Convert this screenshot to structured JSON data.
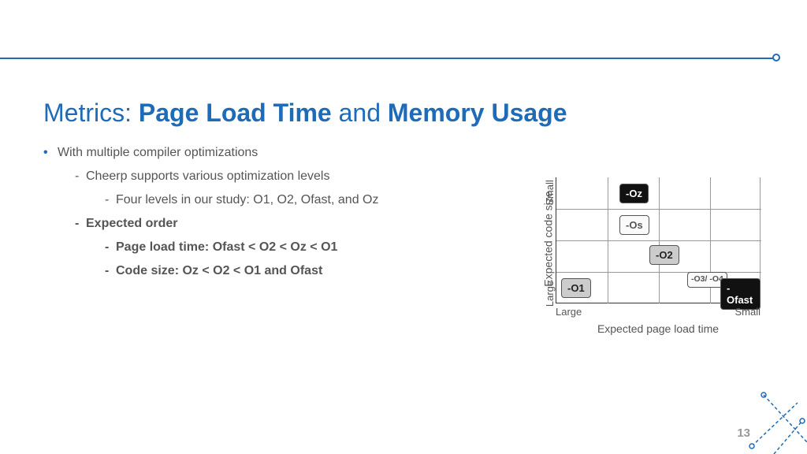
{
  "title": {
    "prefix": "Metrics: ",
    "strong1": "Page Load Time",
    "mid": " and ",
    "strong2": "Memory Usage"
  },
  "bullets": {
    "l1": "With multiple compiler optimizations",
    "l2a": "Cheerp supports various optimization levels",
    "l3a": "Four levels in our study: O1, O2, Ofast, and Oz",
    "l2b": "Expected order",
    "l3b": "Page load time: Ofast < O2 < Oz < O1",
    "l3c": "Code size:  Oz < O2 < O1 and Ofast"
  },
  "chart": {
    "ylabel": "Expected code size",
    "xlabel": "Expected page load time",
    "y_tick_top": "Small",
    "y_tick_bottom": "Large",
    "x_tick_left": "Large",
    "x_tick_right": "Small",
    "boxes": {
      "oz": "-Oz",
      "os": "-Os",
      "o2": "-O2",
      "o1": "-O1",
      "o34": "-O3/\n-O4",
      "ofast": "-Ofast"
    }
  },
  "page_number": "13"
}
